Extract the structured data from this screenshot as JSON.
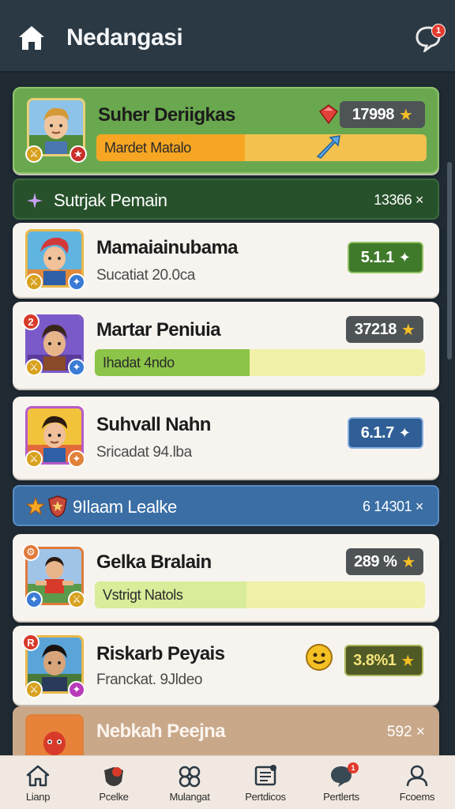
{
  "header": {
    "title": "Nedangasi",
    "home_icon": "home-icon",
    "chat_icon": "chat-bubble-icon",
    "chat_badge": "1"
  },
  "featured": {
    "name": "Suher Deriigkas",
    "score": "17998",
    "bar_label": "Mardet Matalo",
    "bar_percent": 0.45,
    "colors": {
      "card": "#6aa84f",
      "bar_fill": "#f6a623",
      "bar_track": "#f2c14e"
    }
  },
  "section1": {
    "title": "Sutrjak Pemain",
    "count": "13366 ×"
  },
  "cards": [
    {
      "name": "Mamaiainubama",
      "sub": "Sucatiat 20.0ca",
      "score": "5.1.1"
    },
    {
      "name": "Martar Peniuia",
      "score": "37218",
      "bar_label": "Ihadat 4ndo",
      "bar_percent": 0.47,
      "avatar_badge": "2"
    },
    {
      "name": "Suhvall Nahn",
      "sub": "Sricadat 94.lba",
      "score": "6.1.7"
    }
  ],
  "section2": {
    "title": "9Ilaam Lealke",
    "count": "6 14301 ×"
  },
  "cards2": [
    {
      "name": "Gelka Bralain",
      "score": "289 %",
      "bar_label": "Vstrigt Natols",
      "bar_percent": 0.46
    },
    {
      "name": "Riskarb Peyais",
      "sub": "Franckat. 9Jldeo",
      "score": "3.8%1",
      "avatar_badge": "R"
    },
    {
      "name": "Nebkah Peejna",
      "score": "592 ×"
    }
  ],
  "nav": [
    {
      "label": "Lianp",
      "icon": "home-outline-icon"
    },
    {
      "label": "Pcelke",
      "icon": "guild-icon"
    },
    {
      "label": "Mulangat",
      "icon": "gamepad-icon"
    },
    {
      "label": "Pertdicos",
      "icon": "scroll-icon"
    },
    {
      "label": "Pertlerts",
      "icon": "chat-icon",
      "badge": "1"
    },
    {
      "label": "Fcoems",
      "icon": "profile-icon"
    }
  ]
}
